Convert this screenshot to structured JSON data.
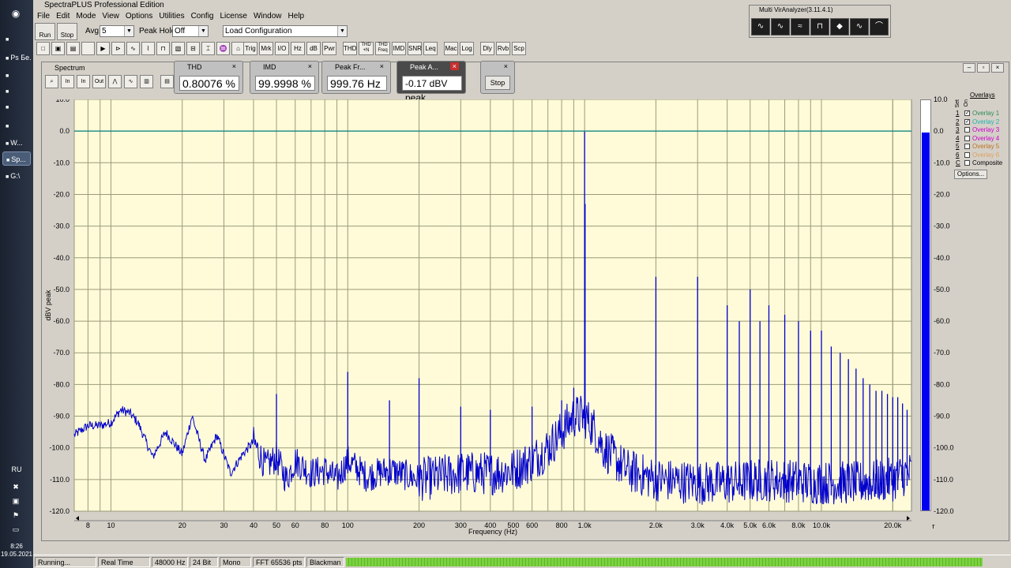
{
  "taskbar": {
    "items": [
      {
        "icon": "chrome-icon",
        "label": "",
        "top": 40
      },
      {
        "icon": "pshop-icon",
        "label": "Ps Бе...",
        "top": 64
      },
      {
        "icon": "app-icon",
        "label": "",
        "top": 86
      },
      {
        "icon": "app-icon",
        "label": "",
        "top": 106
      },
      {
        "icon": "firefox-icon",
        "label": "",
        "top": 126
      },
      {
        "icon": "app-icon",
        "label": "",
        "top": 150
      },
      {
        "icon": "window-icon",
        "label": "W...",
        "top": 172
      },
      {
        "icon": "window-icon",
        "label": "Sp...",
        "top": 192,
        "active": true
      },
      {
        "icon": "folder-icon",
        "label": "G:\\",
        "top": 214
      }
    ],
    "lang": "RU",
    "time": "8:26",
    "date": "19.05.2021"
  },
  "app": {
    "title": "SpectraPLUS Professional Edition",
    "menu": [
      "File",
      "Edit",
      "Mode",
      "View",
      "Options",
      "Utilities",
      "Config",
      "License",
      "Window",
      "Help"
    ],
    "run_label": "Run",
    "stop_label": "Stop",
    "avg_label": "Avg:",
    "avg_value": "5",
    "peakhold_label": "Peak Hold:",
    "peakhold_value": "Off",
    "config_value": "Load Configuration",
    "toolbar2": [
      "Trig",
      "Mrk",
      "I/O",
      "Hz",
      "dB",
      "Pwr",
      "THD",
      "THD +N",
      "THD Freq",
      "IMD",
      "SNR",
      "Leq",
      "Mac",
      "Log",
      "Dly",
      "Rvb",
      "Scp"
    ]
  },
  "multivir": {
    "title": "Multi VirAnalyzer(3.11.4.1)"
  },
  "spectrum_window": {
    "title": "Spectrum",
    "stop_label": "Stop"
  },
  "meters": [
    {
      "name": "THD",
      "value": "0.80076 %"
    },
    {
      "name": "IMD",
      "value": "99.9998 %"
    },
    {
      "name": "Peak Fr...",
      "value": "999.76 Hz"
    },
    {
      "name": "Peak A...",
      "value": "-0.17 dBV peak"
    }
  ],
  "overlays": {
    "header": "Overlays",
    "set_label": "Set",
    "on_label": "On",
    "items": [
      {
        "n": "1",
        "label": "Overlay 1",
        "checked": true,
        "color": "#2e8b57"
      },
      {
        "n": "2",
        "label": "Overlay 2",
        "checked": true,
        "color": "#20b2aa"
      },
      {
        "n": "3",
        "label": "Overlay 3",
        "checked": false,
        "color": "#cc00cc"
      },
      {
        "n": "4",
        "label": "Overlay 4",
        "checked": false,
        "color": "#cc00cc"
      },
      {
        "n": "5",
        "label": "Overlay 5",
        "checked": false,
        "color": "#c07020"
      },
      {
        "n": "6",
        "label": "Overlay 6",
        "checked": false,
        "color": "#e0a060"
      },
      {
        "n": "C",
        "label": "Composite",
        "checked": false,
        "color": "#000000"
      }
    ],
    "options_label": "Options..."
  },
  "status": {
    "state": "Running...",
    "mode": "Real Time",
    "rate": "48000 Hz",
    "bits": "24 Bit",
    "channels": "Mono",
    "fft": "FFT 65536 pts",
    "window": "Blackman"
  },
  "chart_data": {
    "type": "line",
    "xlabel": "Frequency (Hz)",
    "ylabel": "dBV peak",
    "xscale": "log",
    "xlim": [
      7,
      24000
    ],
    "ylim": [
      -120,
      10
    ],
    "grid": true,
    "background": "#fffbd8",
    "line_color": "#0000cc",
    "ref_line": 0,
    "ref_color": "#008080",
    "y_ticks": [
      10,
      0,
      -10,
      -20,
      -30,
      -40,
      -50,
      -60,
      -70,
      -80,
      -90,
      -100,
      -110,
      -120
    ],
    "y_tick_labels": [
      "10.0",
      "0.0",
      "-10.0",
      "-20.0",
      "-30.0",
      "-40.0",
      "-50.0",
      "-60.0",
      "-70.0",
      "-80.0",
      "-90.0",
      "-100.0",
      "-110.0",
      "-120.0"
    ],
    "x_ticks": [
      8,
      10,
      20,
      30,
      40,
      50,
      60,
      80,
      100,
      200,
      300,
      400,
      500,
      600,
      800,
      1000,
      2000,
      3000,
      4000,
      5000,
      6000,
      8000,
      10000,
      20000
    ],
    "x_tick_labels": [
      "8",
      "10",
      "20",
      "30",
      "40",
      "50",
      "60",
      "80",
      "100",
      "200",
      "300",
      "400",
      "500",
      "600",
      "800",
      "1.0k",
      "2.0k",
      "3.0k",
      "4.0k",
      "5.0k",
      "6.0k",
      "8.0k",
      "10.0k",
      "20.0k"
    ],
    "right_axis_label": "Pwr",
    "bar_level": -0.17,
    "noise_floor": [
      [
        7,
        -96
      ],
      [
        8,
        -93
      ],
      [
        9,
        -93
      ],
      [
        10,
        -92
      ],
      [
        11,
        -88
      ],
      [
        12,
        -89
      ],
      [
        13,
        -92
      ],
      [
        15,
        -103
      ],
      [
        17,
        -95
      ],
      [
        20,
        -102
      ],
      [
        22,
        -90
      ],
      [
        25,
        -104
      ],
      [
        28,
        -96
      ],
      [
        32,
        -108
      ],
      [
        36,
        -102
      ],
      [
        40,
        -98
      ],
      [
        45,
        -106
      ],
      [
        50,
        -103
      ],
      [
        55,
        -110
      ],
      [
        60,
        -104
      ],
      [
        70,
        -108
      ],
      [
        80,
        -107
      ],
      [
        90,
        -110
      ],
      [
        100,
        -104
      ],
      [
        120,
        -109
      ],
      [
        150,
        -107
      ],
      [
        200,
        -110
      ],
      [
        250,
        -109
      ],
      [
        300,
        -108
      ],
      [
        400,
        -108
      ],
      [
        500,
        -107
      ],
      [
        600,
        -104
      ],
      [
        700,
        -100
      ],
      [
        800,
        -95
      ],
      [
        900,
        -90
      ],
      [
        1000,
        -90
      ],
      [
        1100,
        -94
      ],
      [
        1200,
        -100
      ],
      [
        1500,
        -107
      ],
      [
        2000,
        -110
      ],
      [
        3000,
        -111
      ],
      [
        4000,
        -111
      ],
      [
        6000,
        -110
      ],
      [
        10000,
        -111
      ],
      [
        15000,
        -111
      ],
      [
        20000,
        -110
      ],
      [
        23000,
        -108
      ]
    ],
    "peaks": [
      [
        50,
        -83
      ],
      [
        100,
        -76
      ],
      [
        150,
        -85
      ],
      [
        200,
        -78
      ],
      [
        300,
        -87
      ],
      [
        400,
        -88
      ],
      [
        600,
        -87
      ],
      [
        800,
        -85
      ],
      [
        900,
        -81
      ],
      [
        1000,
        -0.17
      ],
      [
        1005,
        -23
      ],
      [
        2000,
        -46
      ],
      [
        3000,
        -46
      ],
      [
        4000,
        -55
      ],
      [
        4500,
        -60
      ],
      [
        5000,
        -50
      ],
      [
        5500,
        -60
      ],
      [
        6000,
        -55
      ],
      [
        7000,
        -58
      ],
      [
        8000,
        -60
      ],
      [
        9000,
        -63
      ],
      [
        10000,
        -63
      ],
      [
        11000,
        -68
      ],
      [
        12000,
        -70
      ],
      [
        13000,
        -72
      ],
      [
        14000,
        -75
      ],
      [
        15000,
        -78
      ],
      [
        16000,
        -80
      ],
      [
        17000,
        -82
      ],
      [
        18000,
        -82
      ],
      [
        19000,
        -83
      ],
      [
        20000,
        -84
      ],
      [
        21000,
        -84
      ],
      [
        22000,
        -86
      ],
      [
        23000,
        -88
      ]
    ]
  }
}
